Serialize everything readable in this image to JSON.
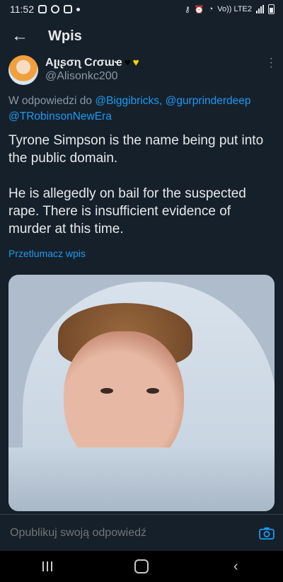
{
  "status_bar": {
    "time": "11:52",
    "network": "Vo)) LTE2"
  },
  "app_bar": {
    "title": "Wpis"
  },
  "tweet": {
    "display_name": "Aլιʂσɳ Cɾσɯҽ",
    "handle": "@Alisonkc200",
    "reply_prefix": "W odpowiedzi do",
    "mentions": [
      "@Biggibricks,",
      "@gurprinderdeep",
      "@TRobinsonNewEra"
    ],
    "text": "Tyrone Simpson is the name being put into the public domain.\n\nHe is allegedly on bail for the suspected rape. There is insufficient evidence of murder at this time.",
    "translate_label": "Przetlumacz wpis"
  },
  "reply": {
    "placeholder": "Opublikuj swoją odpowiedź"
  },
  "colors": {
    "background": "#15202b",
    "accent": "#1d9bf0",
    "secondary_text": "#8b98a5"
  },
  "icons": {
    "back": "arrow-left-icon",
    "more": "more-vertical-icon",
    "camera": "camera-icon"
  }
}
